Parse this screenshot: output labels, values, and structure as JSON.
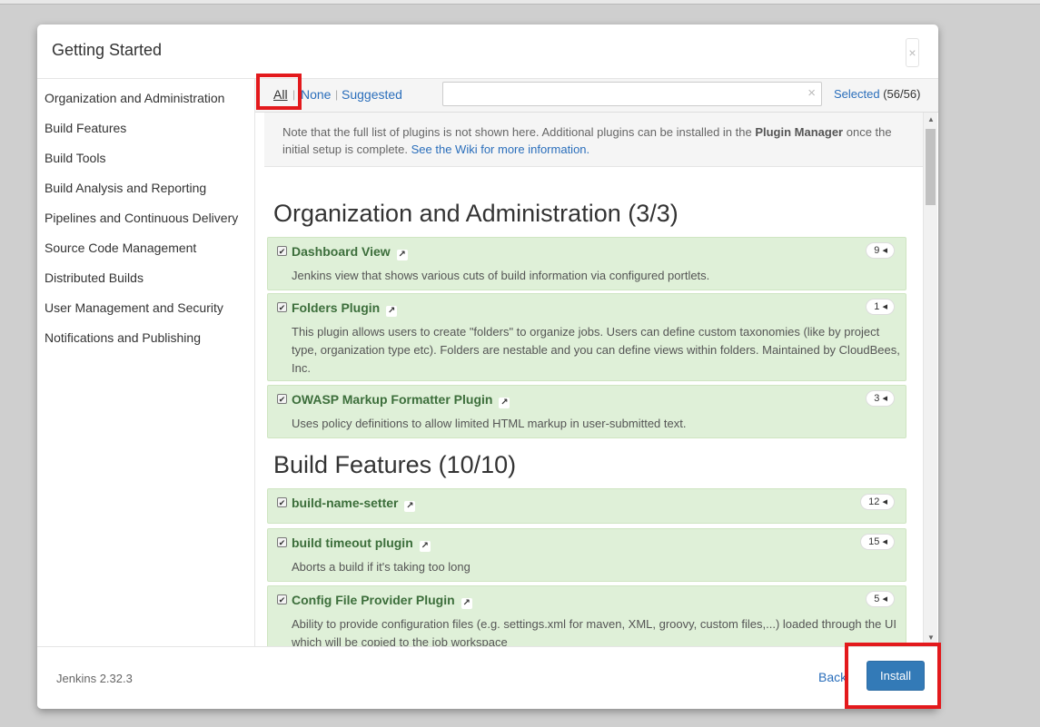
{
  "dialog": {
    "title": "Getting Started",
    "close_glyph": "×"
  },
  "sidebar": {
    "items": [
      {
        "label": "Organization and Administration"
      },
      {
        "label": "Build Features"
      },
      {
        "label": "Build Tools"
      },
      {
        "label": "Build Analysis and Reporting"
      },
      {
        "label": "Pipelines and Continuous Delivery"
      },
      {
        "label": "Source Code Management"
      },
      {
        "label": "Distributed Builds"
      },
      {
        "label": "User Management and Security"
      },
      {
        "label": "Notifications and Publishing"
      }
    ]
  },
  "filter": {
    "all_label": "All",
    "none_label": "None",
    "suggested_label": "Suggested",
    "separator": "|",
    "search_value": "",
    "clear_glyph": "×",
    "selected_label": "Selected",
    "selected_count": "(56/56)"
  },
  "note": {
    "text_before": "Note that the full list of plugins is not shown here. Additional plugins can be installed in the ",
    "bold": "Plugin Manager",
    "text_after": " once the initial setup is complete. ",
    "link": "See the Wiki for more information."
  },
  "sections": [
    {
      "title": "Organization and Administration (3/3)",
      "plugins": [
        {
          "name": "Dashboard View",
          "deps": "9",
          "description": "Jenkins view that shows various cuts of build information via configured portlets."
        },
        {
          "name": "Folders Plugin",
          "deps": "1",
          "description": "This plugin allows users to create \"folders\" to organize jobs. Users can define custom taxonomies (like by project type, organization type etc). Folders are nestable and you can define views within folders. Maintained by CloudBees, Inc."
        },
        {
          "name": "OWASP Markup Formatter Plugin",
          "deps": "3",
          "description": "Uses policy definitions to allow limited HTML markup in user-submitted text."
        }
      ]
    },
    {
      "title": "Build Features (10/10)",
      "plugins": [
        {
          "name": "build-name-setter",
          "deps": "12",
          "description": ""
        },
        {
          "name": "build timeout plugin",
          "deps": "15",
          "description": "Aborts a build if it's taking too long"
        },
        {
          "name": "Config File Provider Plugin",
          "deps": "5",
          "description": "Ability to provide configuration files (e.g. settings.xml for maven, XML, groovy, custom files,...) loaded through the UI which will be copied to the job workspace"
        }
      ]
    }
  ],
  "icons": {
    "checkbox": "checkbox-checked-icon",
    "external_link": "external-link-icon",
    "dependencies_toggle": "caret-left-icon"
  },
  "glyphs": {
    "check": "✔",
    "external_link": "↗",
    "caret_left": "◂",
    "scroll_up": "▲",
    "scroll_down": "▼"
  },
  "footer": {
    "version": "Jenkins 2.32.3",
    "back_label": "Back",
    "install_label": "Install"
  },
  "colors": {
    "plugin_bg": "#dff0d8",
    "plugin_name": "#3c6e3b",
    "link": "#2a6ebb",
    "primary_button": "#337ab7",
    "highlight": "#e3191c"
  }
}
